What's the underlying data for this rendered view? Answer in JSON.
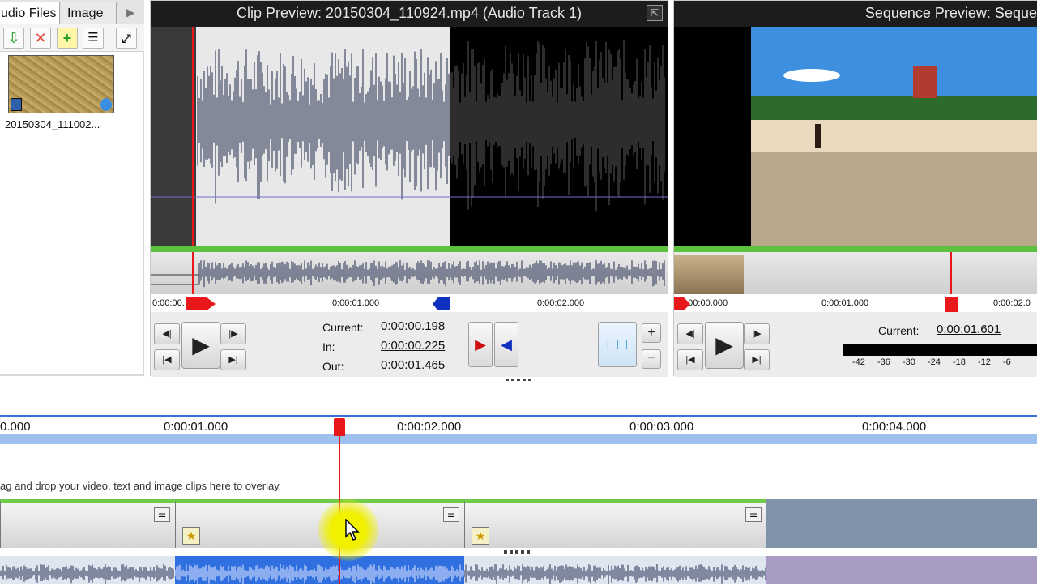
{
  "media_bin": {
    "tabs": [
      "udio Files",
      "Image"
    ],
    "thumb_label": "20150304_111002..."
  },
  "clip_preview": {
    "title": "Clip Preview: 20150304_110924.mp4 (Audio Track 1)",
    "ruler": [
      "0:00:00.",
      "0:00:01.000",
      "0:00:02.000"
    ],
    "current_label": "Current:",
    "current_value": "0:00:00.198",
    "in_label": "In:",
    "in_value": "0:00:00.225",
    "out_label": "Out:",
    "out_value": "0:00:01.465"
  },
  "sequence_preview": {
    "title": "Sequence Preview: Seque",
    "ruler": [
      "0:00:00.000",
      "0:00:01.000",
      "0:00:02.0"
    ],
    "current_label": "Current:",
    "current_value": "0:00:01.601",
    "meter_ticks": [
      "-42",
      "-36",
      "-30",
      "-24",
      "-18",
      "-12",
      "-6"
    ]
  },
  "timeline": {
    "ruler": [
      "0.000",
      "0:00:01.000",
      "0:00:02.000",
      "0:00:03.000",
      "0:00:04.000"
    ],
    "overlay_hint": "ag and drop your video, text and image clips here to overlay"
  },
  "colors": {
    "playhead": "#e8171b",
    "clip_green": "#6fcc4a",
    "ruler_band": "#9ec0ee",
    "wave_dark": "#1f2a4d"
  }
}
